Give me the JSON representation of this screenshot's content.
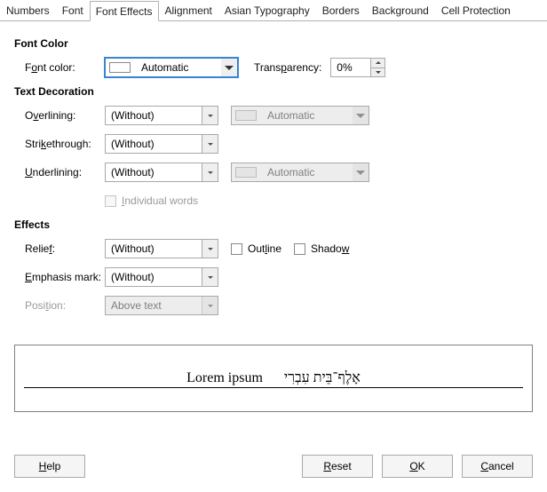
{
  "tabs": {
    "numbers": "Numbers",
    "font": "Font",
    "font_effects": "Font Effects",
    "alignment": "Alignment",
    "asian_typo": "Asian Typography",
    "borders": "Borders",
    "background": "Background",
    "cell_protection": "Cell Protection"
  },
  "sections": {
    "font_color_title": "Font Color",
    "text_decoration_title": "Text Decoration",
    "effects_title": "Effects"
  },
  "font_color": {
    "label_pre": "F",
    "label_ul": "o",
    "label_post": "nt color:",
    "value": "Automatic",
    "transparency_pre": "Trans",
    "transparency_ul": "p",
    "transparency_post": "arency:",
    "transparency_value": "0%"
  },
  "text_deco": {
    "overlining_pre": "O",
    "overlining_ul": "v",
    "overlining_post": "erlining:",
    "overlining_value": "(Without)",
    "overlining_color": "Automatic",
    "strike_pre": "Stri",
    "strike_ul": "k",
    "strike_post": "ethrough:",
    "strike_value": "(Without)",
    "underlining_pre": "",
    "underlining_ul": "U",
    "underlining_post": "nderlining:",
    "underlining_value": "(Without)",
    "underlining_color": "Automatic",
    "individual_pre": "",
    "individual_ul": "I",
    "individual_post": "ndividual words"
  },
  "effects": {
    "relief_pre": "Relie",
    "relief_ul": "f",
    "relief_post": ":",
    "relief_value": "(Without)",
    "outline_pre": "Out",
    "outline_ul": "l",
    "outline_post": "ine",
    "shadow_pre": "Shado",
    "shadow_ul": "w",
    "shadow_post": "",
    "emphasis_pre": "",
    "emphasis_ul": "E",
    "emphasis_post": "mphasis mark:",
    "emphasis_value": "(Without)",
    "position_pre": "Posi",
    "position_ul": "t",
    "position_post": "ion:",
    "position_value": "Above text"
  },
  "preview": {
    "latin": "Lorem ipsum",
    "hebrew": "אָלֶף־בֵּית עִבְרִי"
  },
  "buttons": {
    "help_ul": "H",
    "help_post": "elp",
    "reset_ul": "R",
    "reset_post": "eset",
    "ok_ul": "O",
    "ok_post": "K",
    "cancel_ul": "C",
    "cancel_post": "ancel"
  }
}
